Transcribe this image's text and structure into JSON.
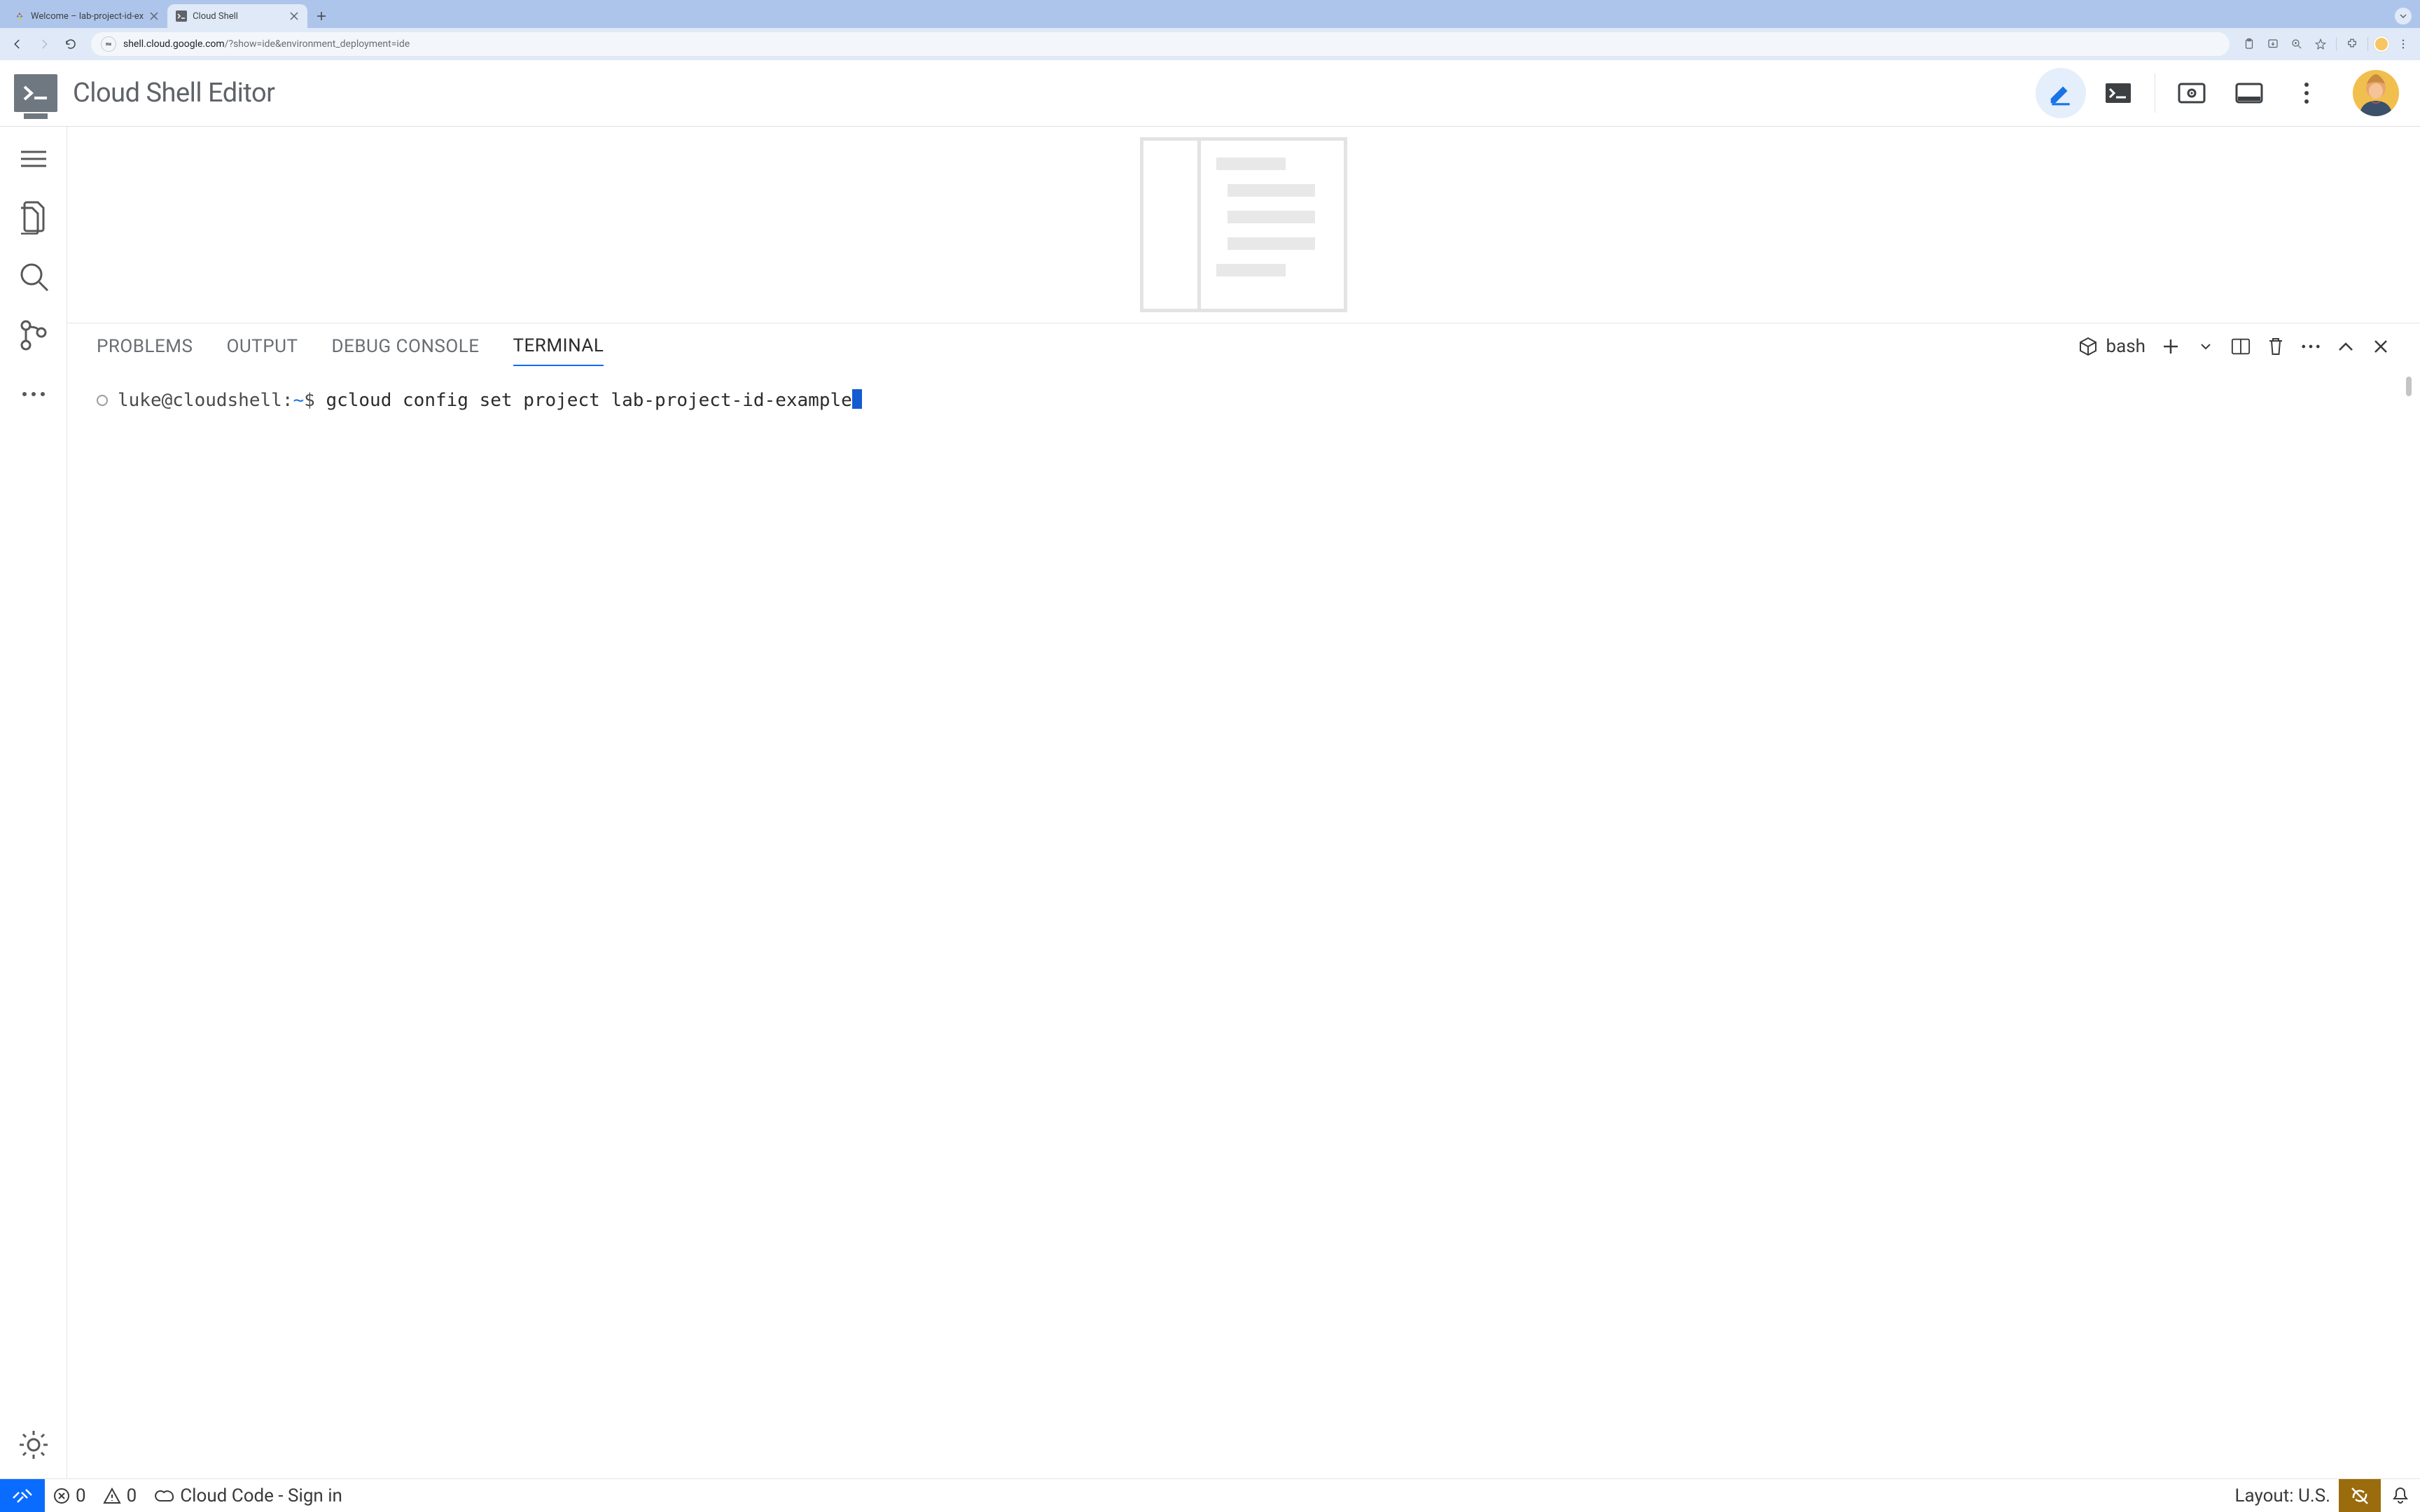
{
  "browser": {
    "tabs": [
      {
        "title": "Welcome – lab-project-id-ex",
        "active": false
      },
      {
        "title": "Cloud Shell",
        "active": true
      }
    ],
    "url_host": "shell.cloud.google.com",
    "url_rest": "/?show=ide&environment_deployment=ide"
  },
  "header": {
    "title": "Cloud Shell Editor"
  },
  "panel": {
    "tabs": {
      "problems": "PROBLEMS",
      "output": "OUTPUT",
      "debug": "DEBUG CONSOLE",
      "terminal": "TERMINAL"
    },
    "shell_name": "bash"
  },
  "terminal": {
    "user_host": "luke@cloudshell",
    "cwd": "~",
    "prompt_suffix": "$",
    "command": "gcloud config set project lab-project-id-example"
  },
  "status": {
    "errors": "0",
    "warnings": "0",
    "cloud_code": "Cloud Code - Sign in",
    "layout": "Layout: U.S."
  }
}
